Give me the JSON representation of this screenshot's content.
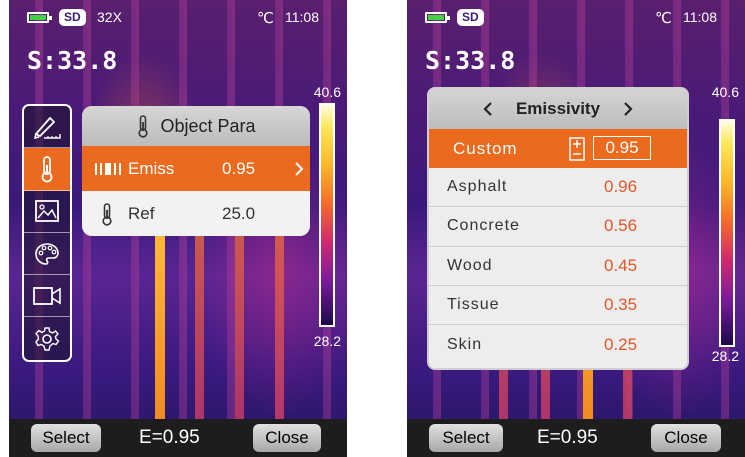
{
  "left_screen": {
    "status": {
      "sd": "SD",
      "zoom": "32X",
      "unit": "℃",
      "time": "11:08"
    },
    "spot_temp": "S:33.8",
    "scale": {
      "max": "40.6",
      "min": "28.2"
    },
    "side_menu": [
      {
        "icon": "ruler-pen-icon"
      },
      {
        "icon": "thermometer-icon",
        "active": true
      },
      {
        "icon": "image-icon"
      },
      {
        "icon": "palette-icon"
      },
      {
        "icon": "video-camera-icon"
      },
      {
        "icon": "gear-icon"
      }
    ],
    "object_para": {
      "title": "Object Para",
      "rows": [
        {
          "label": "Emiss",
          "value": "0.95",
          "selected": true
        },
        {
          "label": "Ref",
          "value": "25.0"
        }
      ]
    },
    "bottom": {
      "select_label": "Select",
      "emissivity": "E=0.95",
      "close_label": "Close"
    }
  },
  "right_screen": {
    "status": {
      "sd": "SD",
      "unit": "℃",
      "time": "11:08"
    },
    "spot_temp": "S:33.8",
    "scale": {
      "max": "40.6",
      "min": "28.2"
    },
    "emissivity_menu": {
      "title": "Emissivity",
      "items": [
        {
          "name": "Custom",
          "value": "0.95",
          "selected": true
        },
        {
          "name": "Asphalt",
          "value": "0.96"
        },
        {
          "name": "Concrete",
          "value": "0.56"
        },
        {
          "name": "Wood",
          "value": "0.45"
        },
        {
          "name": "Tissue",
          "value": "0.35"
        },
        {
          "name": "Skin",
          "value": "0.25"
        }
      ]
    },
    "bottom": {
      "select_label": "Select",
      "emissivity": "E=0.95",
      "close_label": "Close"
    }
  },
  "colors": {
    "accent": "#ec6a1e",
    "value_text": "#e2572a",
    "panel_bg": "#f2f2f2",
    "bottom_bar": "#1d1d1d"
  }
}
